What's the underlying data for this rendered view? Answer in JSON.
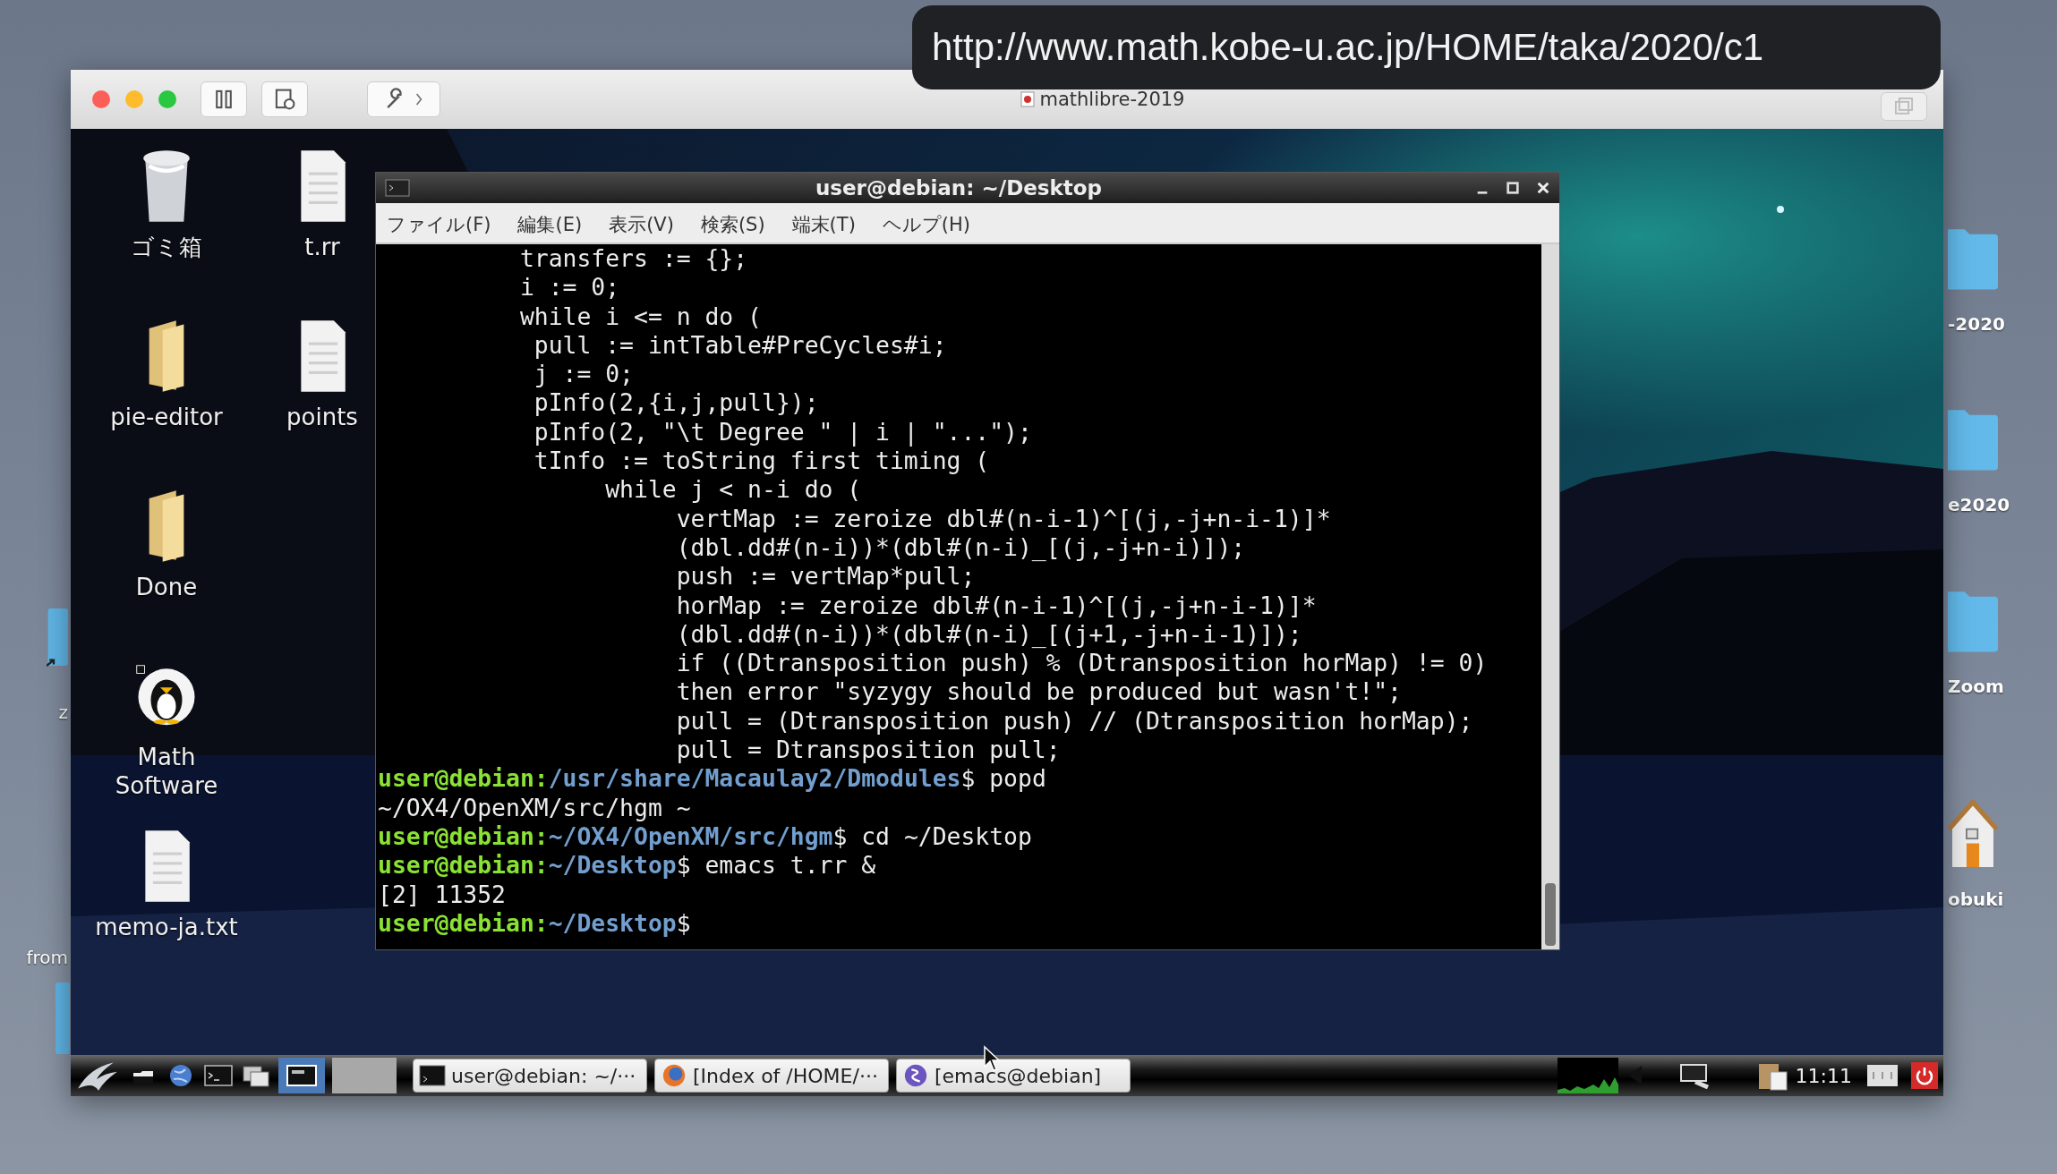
{
  "url_overlay": "http://www.math.kobe-u.ac.jp/HOME/taka/2020/c1",
  "host_icons_left": [
    {
      "kind": "alias",
      "label": "z"
    },
    {
      "kind": "none",
      "label": "from"
    }
  ],
  "host_icons_right": [
    {
      "kind": "folder",
      "label": "-2020"
    },
    {
      "kind": "folder",
      "label": "e2020"
    },
    {
      "kind": "folder",
      "label": "Zoom"
    },
    {
      "kind": "home",
      "label": "obuki"
    }
  ],
  "vm_window": {
    "title": "mathlibre-2019"
  },
  "desktop_icons": [
    [
      {
        "kind": "trash",
        "label": "ゴミ箱"
      },
      {
        "kind": "folder",
        "label": "pie-editor"
      },
      {
        "kind": "folder",
        "label": "Done"
      },
      {
        "kind": "app",
        "label": "Math Software"
      },
      {
        "kind": "file",
        "label": "memo-ja.txt"
      }
    ],
    [
      {
        "kind": "file",
        "label": "t.rr"
      },
      {
        "kind": "file",
        "label": "points"
      }
    ]
  ],
  "terminal": {
    "title": "user@debian: ~/Desktop",
    "menu": [
      "ファイル(F)",
      "編集(E)",
      "表示(V)",
      "検索(S)",
      "端末(T)",
      "ヘルプ(H)"
    ],
    "lines": [
      {
        "kind": "code",
        "text": "          transfers := {};"
      },
      {
        "kind": "code",
        "text": "          i := 0;"
      },
      {
        "kind": "code",
        "text": "          while i <= n do ("
      },
      {
        "kind": "code",
        "text": "           pull := intTable#PreCycles#i;"
      },
      {
        "kind": "code",
        "text": "           j := 0;"
      },
      {
        "kind": "code",
        "text": "           pInfo(2,{i,j,pull});"
      },
      {
        "kind": "code",
        "text": "           pInfo(2, \"\\t Degree \" | i | \"...\");"
      },
      {
        "kind": "code",
        "text": "           tInfo := toString first timing ("
      },
      {
        "kind": "code",
        "text": "                while j < n-i do ("
      },
      {
        "kind": "code",
        "text": "                     vertMap := zeroize dbl#(n-i-1)^[(j,-j+n-i-1)]*"
      },
      {
        "kind": "code",
        "text": "                     (dbl.dd#(n-i))*(dbl#(n-i)_[(j,-j+n-i)]);"
      },
      {
        "kind": "code",
        "text": "                     push := vertMap*pull;"
      },
      {
        "kind": "code",
        "text": "                     horMap := zeroize dbl#(n-i-1)^[(j,-j+n-i-1)]*"
      },
      {
        "kind": "code",
        "text": "                     (dbl.dd#(n-i))*(dbl#(n-i)_[(j+1,-j+n-i-1)]);"
      },
      {
        "kind": "code",
        "text": "                     if ((Dtransposition push) % (Dtransposition horMap) != 0)"
      },
      {
        "kind": "code",
        "text": "                     then error \"syzygy should be produced but wasn't!\";"
      },
      {
        "kind": "code",
        "text": "                     pull = (Dtransposition push) // (Dtransposition horMap);"
      },
      {
        "kind": "code",
        "text": "                     pull = Dtransposition pull;"
      },
      {
        "kind": "prompt",
        "user": "user@debian:",
        "path": "/usr/share/Macaulay2/Dmodules",
        "command": "$ popd"
      },
      {
        "kind": "code",
        "text": "~/OX4/OpenXM/src/hgm ~"
      },
      {
        "kind": "prompt",
        "user": "user@debian:",
        "path": "~/OX4/OpenXM/src/hgm",
        "command": "$ cd ~/Desktop"
      },
      {
        "kind": "prompt",
        "user": "user@debian:",
        "path": "~/Desktop",
        "command": "$ emacs t.rr &"
      },
      {
        "kind": "code",
        "text": "[2] 11352"
      },
      {
        "kind": "prompt",
        "user": "user@debian:",
        "path": "~/Desktop",
        "command": "$"
      }
    ]
  },
  "taskbar": {
    "tasks": [
      {
        "kind": "terminal",
        "label": "user@debian: ~/···"
      },
      {
        "kind": "browser",
        "label": "[Index of /HOME/···"
      },
      {
        "kind": "emacs",
        "label": "[emacs@debian]"
      }
    ],
    "clock": "11:11"
  }
}
